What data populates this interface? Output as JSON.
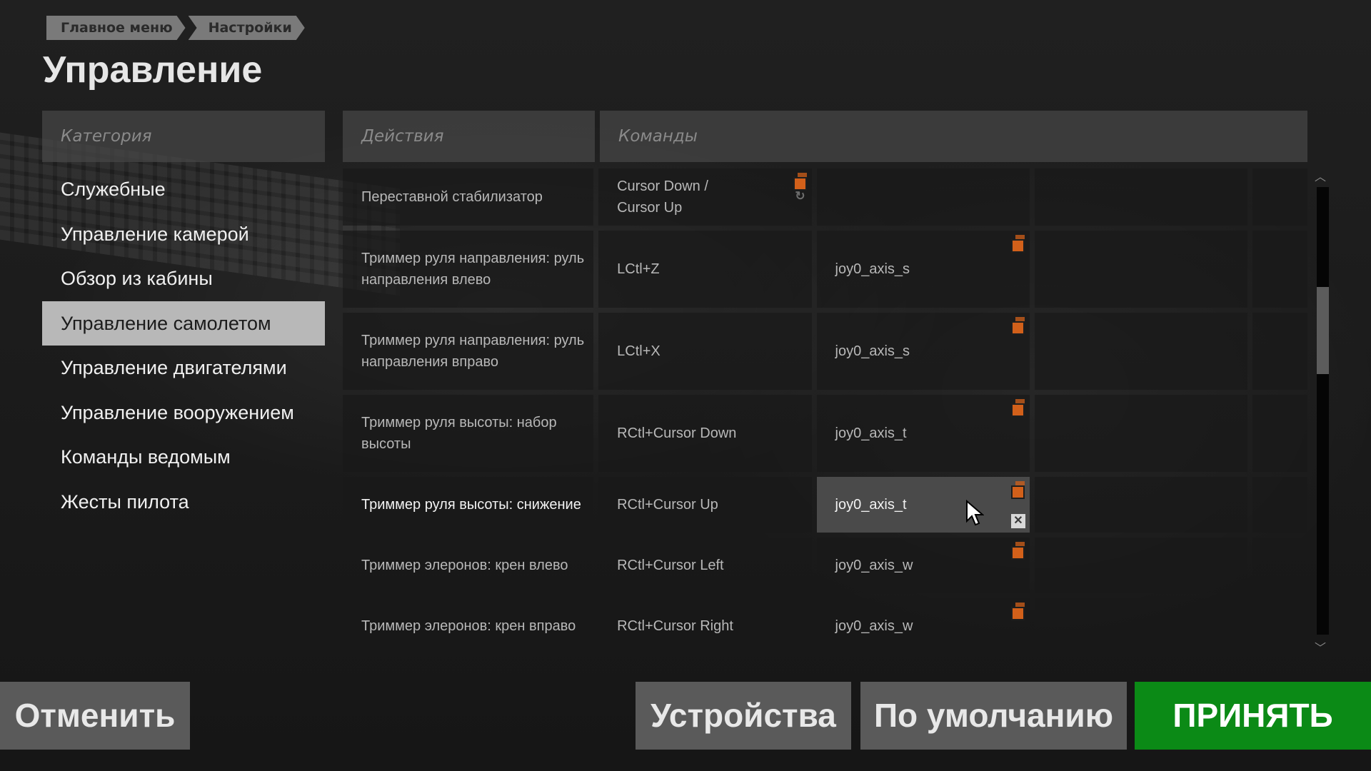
{
  "breadcrumb": [
    "Главное меню",
    "Настройки"
  ],
  "page_title": "Управление",
  "headers": {
    "category": "Категория",
    "actions": "Действия",
    "commands": "Команды"
  },
  "categories": [
    {
      "label": "Служебные",
      "selected": false
    },
    {
      "label": "Управление камерой",
      "selected": false
    },
    {
      "label": "Обзор из кабины",
      "selected": false
    },
    {
      "label": "Управление самолетом",
      "selected": true
    },
    {
      "label": "Управление двигателями",
      "selected": false
    },
    {
      "label": "Управление вооружением",
      "selected": false
    },
    {
      "label": "Команды ведомым",
      "selected": false
    },
    {
      "label": "Жесты пилота",
      "selected": false
    }
  ],
  "rows": [
    {
      "action": "Переставной стабилизатор",
      "keys": [
        "Cursor Down /\nCursor Up",
        "",
        "",
        ""
      ]
    },
    {
      "action": "Триммер руля направления: руль направления влево",
      "keys": [
        "LCtl+Z",
        "joy0_axis_s",
        "",
        ""
      ]
    },
    {
      "action": "Триммер руля направления: руль направления вправо",
      "keys": [
        "LCtl+X",
        "joy0_axis_s",
        "",
        ""
      ]
    },
    {
      "action": "Триммер руля высоты: набор высоты",
      "keys": [
        "RCtl+Cursor Down",
        "joy0_axis_t",
        "",
        ""
      ]
    },
    {
      "action": "Триммер руля высоты: снижение",
      "keys": [
        "RCtl+Cursor Up",
        "joy0_axis_t",
        "",
        ""
      ]
    },
    {
      "action": "Триммер элеронов: крен влево",
      "keys": [
        "RCtl+Cursor Left",
        "joy0_axis_w",
        "",
        ""
      ]
    },
    {
      "action": "Триммер элеронов: крен вправо",
      "keys": [
        "RCtl+Cursor Right",
        "joy0_axis_w",
        "",
        ""
      ]
    }
  ],
  "buttons": {
    "cancel": "Отменить",
    "devices": "Устройства",
    "default": "По умолчанию",
    "accept": "ПРИНЯТЬ"
  },
  "icons": {
    "copy": "copy-icon",
    "reset": "reset-icon",
    "close": "close-icon",
    "close_glyph": "✕",
    "reset_glyph": "↻",
    "scroll_up_glyph": "︿",
    "scroll_down_glyph": "﹀"
  },
  "colors": {
    "accent_orange": "#d2601a",
    "accept_green": "#0b8a16",
    "selected_category": "#b8b8b8"
  }
}
